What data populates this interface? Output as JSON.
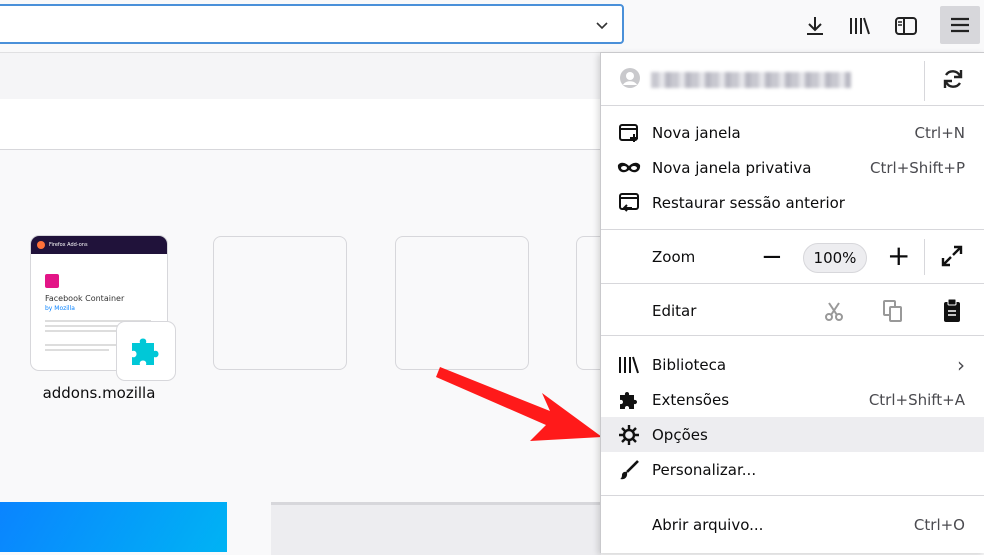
{
  "toolbar": {
    "dropdown_icon": "chevron-down-icon",
    "icons": [
      "download-icon",
      "library-icon",
      "sidebar-icon",
      "hamburger-menu-icon"
    ]
  },
  "newtab": {
    "tiles": [
      {
        "label": "addons.mozilla",
        "thumb_brand": "Firefox Add-ons",
        "thumb_title": "Facebook Container",
        "thumb_by": "by Mozilla"
      },
      {
        "label": ""
      },
      {
        "label": ""
      },
      {
        "label": ""
      }
    ]
  },
  "menu": {
    "account_email": "",
    "items": [
      {
        "label": "Nova janela",
        "shortcut": "Ctrl+N",
        "icon": "new-window-icon"
      },
      {
        "label": "Nova janela privativa",
        "shortcut": "Ctrl+Shift+P",
        "icon": "private-mask-icon"
      },
      {
        "label": "Restaurar sessão anterior",
        "shortcut": "",
        "icon": "restore-session-icon"
      }
    ],
    "zoom": {
      "label": "Zoom",
      "minus": "−",
      "value": "100%",
      "plus": "+",
      "fullscreen_icon": "fullscreen-icon"
    },
    "edit": {
      "label": "Editar",
      "icons": [
        "cut-icon",
        "copy-icon",
        "paste-icon"
      ]
    },
    "items2": [
      {
        "label": "Biblioteca",
        "shortcut": "›",
        "icon": "library-icon"
      },
      {
        "label": "Extensões",
        "shortcut": "Ctrl+Shift+A",
        "icon": "puzzle-icon"
      },
      {
        "label": "Opções",
        "shortcut": "",
        "icon": "gear-icon",
        "highlighted": true
      },
      {
        "label": "Personalizar...",
        "shortcut": "",
        "icon": "paintbrush-icon"
      }
    ],
    "items3": [
      {
        "label": "Abrir arquivo...",
        "shortcut": "Ctrl+O"
      }
    ]
  },
  "colors": {
    "accent": "#4a90d9",
    "arrow": "#ff1a1a",
    "highlight": "#ededf0"
  }
}
